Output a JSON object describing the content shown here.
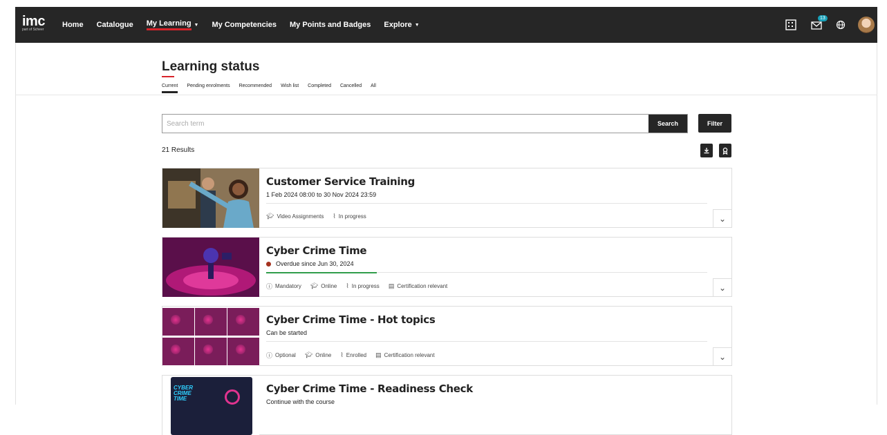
{
  "header": {
    "logo_main": "imc",
    "logo_sub": "part of Scheer",
    "nav": [
      {
        "label": "Home",
        "dropdown": false
      },
      {
        "label": "Catalogue",
        "dropdown": false
      },
      {
        "label": "My Learning",
        "dropdown": true,
        "active": true
      },
      {
        "label": "My Competencies",
        "dropdown": false
      },
      {
        "label": "My Points and Badges",
        "dropdown": false
      },
      {
        "label": "Explore",
        "dropdown": true
      }
    ],
    "notification_count": "13",
    "icons": [
      "building-icon",
      "mail-icon",
      "globe-icon",
      "user-avatar"
    ]
  },
  "page": {
    "title": "Learning status",
    "tabs": [
      "Current",
      "Pending enrolments",
      "Recommended",
      "Wish list",
      "Completed",
      "Cancelled",
      "All"
    ],
    "active_tab": "Current"
  },
  "search": {
    "placeholder": "Search term",
    "value": "",
    "button_label": "Search",
    "filter_label": "Filter"
  },
  "results": {
    "count_label": "21 Results"
  },
  "courses": [
    {
      "title": "Customer Service Training",
      "subtitle": "1 Feb 2024 08:00 to 30 Nov 2024 23:59",
      "meta": [
        "Video Assignments",
        "In progress"
      ],
      "meta_icons": [
        "graduation-cap-icon",
        "activity-icon"
      ]
    },
    {
      "title": "Cyber Crime Time",
      "subtitle": "Overdue since Jun 30, 2024",
      "status_color": "#a5321f",
      "progress": 0.25,
      "meta": [
        "Mandatory",
        "Online",
        "In progress",
        "Certification relevant"
      ],
      "meta_icons": [
        "info-icon",
        "graduation-cap-icon",
        "activity-icon",
        "certificate-icon"
      ]
    },
    {
      "title": "Cyber Crime Time - Hot topics",
      "subtitle": "Can be started",
      "meta": [
        "Optional",
        "Online",
        "Enrolled",
        "Certification relevant"
      ],
      "meta_icons": [
        "info-icon",
        "graduation-cap-icon",
        "activity-icon",
        "certificate-icon"
      ]
    },
    {
      "title": "Cyber Crime Time - Readiness Check",
      "subtitle": "Continue with the course",
      "thumb_text": "CYBER CRIME TIME"
    }
  ],
  "colors": {
    "header_bg": "#262626",
    "accent_red": "#d8232a",
    "progress_green": "#2f9d4a",
    "badge_teal": "#18a0b8"
  }
}
